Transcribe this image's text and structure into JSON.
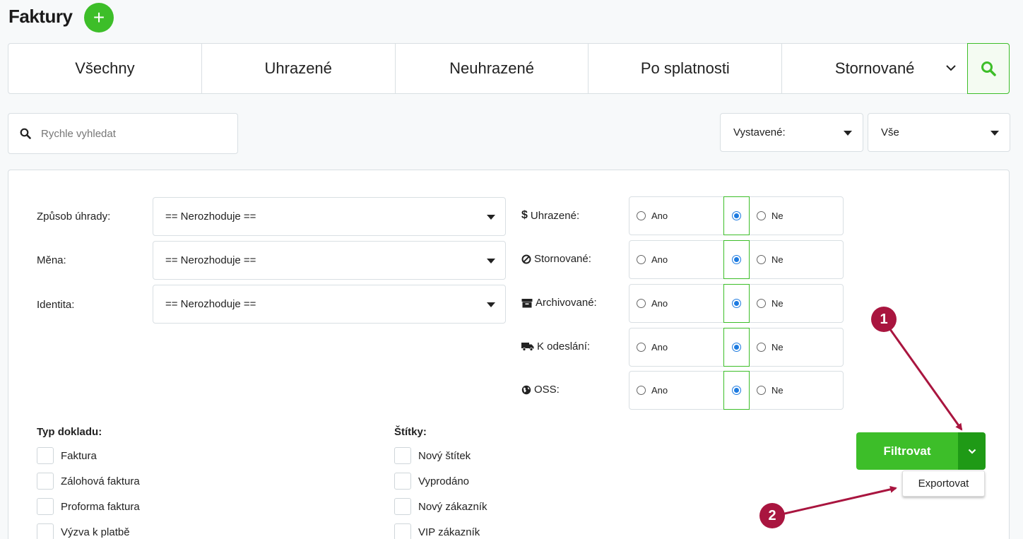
{
  "page": {
    "title": "Faktury",
    "add_icon": "plus-icon"
  },
  "tabs": [
    {
      "label": "Všechny"
    },
    {
      "label": "Uhrazené"
    },
    {
      "label": "Neuhrazené"
    },
    {
      "label": "Po splatnosti"
    },
    {
      "label": "Stornované"
    }
  ],
  "search": {
    "placeholder": "Rychle vyhledat"
  },
  "top_selects": {
    "issued": "Vystavené:",
    "scope": "Vše"
  },
  "filters": [
    {
      "label": "Způsob úhrady:",
      "value": "== Nerozhoduje =="
    },
    {
      "label": "Měna:",
      "value": "== Nerozhoduje =="
    },
    {
      "label": "Identita:",
      "value": "== Nerozhoduje =="
    }
  ],
  "radio_filters": [
    {
      "icon": "dollar-icon",
      "label": "Uhrazené:",
      "yes": "Ano",
      "no": "Ne"
    },
    {
      "icon": "ban-icon",
      "label": "Stornované:",
      "yes": "Ano",
      "no": "Ne"
    },
    {
      "icon": "archive-icon",
      "label": "Archivované:",
      "yes": "Ano",
      "no": "Ne"
    },
    {
      "icon": "truck-icon",
      "label": "K odeslání:",
      "yes": "Ano",
      "no": "Ne"
    },
    {
      "icon": "globe-icon",
      "label": "OSS:",
      "yes": "Ano",
      "no": "Ne"
    }
  ],
  "doc_types": {
    "title": "Typ dokladu:",
    "items": [
      "Faktura",
      "Zálohová faktura",
      "Proforma faktura",
      "Výzva k platbě"
    ]
  },
  "tags": {
    "title": "Štítky:",
    "items": [
      "Nový štítek",
      "Vyprodáno",
      "Nový zákazník",
      "VIP zákazník"
    ]
  },
  "actions": {
    "filter": "Filtrovat",
    "export": "Exportovat"
  },
  "annotations": {
    "marker1": "1",
    "marker2": "2",
    "color": "#a9153f"
  },
  "colors": {
    "accent": "#3dbe29",
    "accent_dark": "#1f9a16",
    "radio_selected": "#1e7be0"
  }
}
